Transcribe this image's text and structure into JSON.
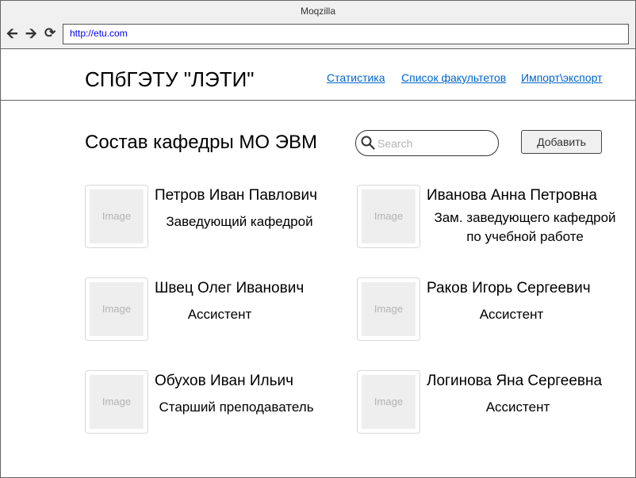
{
  "browser": {
    "window_title": "Moqzilla",
    "url": "http://etu.com"
  },
  "header": {
    "site_title": "СПбГЭТУ \"ЛЭТИ\"",
    "nav": [
      {
        "label": "Статистика"
      },
      {
        "label": "Список факультетов"
      },
      {
        "label": "Импорт\\экспорт"
      }
    ]
  },
  "main": {
    "page_title": "Состав кафедры МО ЭВМ",
    "search": {
      "placeholder": "Search"
    },
    "add_button_label": "Добавить",
    "image_placeholder": "Image",
    "people": [
      {
        "name": "Петров Иван Павлович",
        "role": "Заведующий кафедрой"
      },
      {
        "name": "Иванова Анна Петровна",
        "role_line1": "Зам. заведующего кафедрой",
        "role_line2": "по учебной работе"
      },
      {
        "name": "Швец Олег Иванович",
        "role": "Ассистент"
      },
      {
        "name": "Раков Игорь Сергеевич",
        "role": "Ассистент"
      },
      {
        "name": "Обухов Иван Ильич",
        "role": "Старший преподаватель"
      },
      {
        "name": "Логинова Яна Сергеевна",
        "role": "Ассистент"
      }
    ]
  }
}
